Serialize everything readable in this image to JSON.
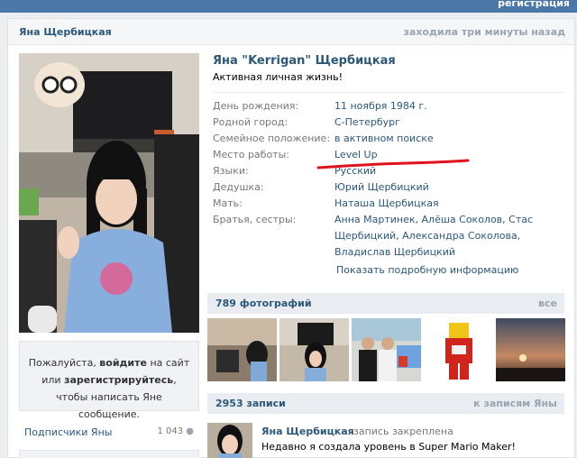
{
  "topbar": {
    "register_label": "регистрация",
    "accent": "#4a76a8"
  },
  "header": {
    "name": "Яна Щербицкая",
    "last_seen": "заходила три минуты назад"
  },
  "profile": {
    "full_name": "Яна \"Kerrigan\" Щербицкая",
    "status": "Активная личная жизнь!",
    "info": [
      {
        "label": "День рождения:",
        "value": "11 ноября 1984 г."
      },
      {
        "label": "Родной город:",
        "value": "С-Петербург"
      },
      {
        "label": "Семейное положение:",
        "value": "в активном поиске"
      },
      {
        "label": "Место работы:",
        "value": "Level Up"
      },
      {
        "label": "Языки:",
        "value": "Русский"
      },
      {
        "label": "Дедушка:",
        "value": "Юрий Щербицкий"
      },
      {
        "label": "Мать:",
        "value": "Наташа Щербицкая"
      },
      {
        "label": "Братья, сестры:",
        "value": "Анна Мартинек, Алёша Соколов, Стас Щербицкий, Александра Соколова, Владислав Щербицкий"
      }
    ],
    "show_more": "Показать подробную информацию"
  },
  "guest_box": {
    "part1": "Пожалуйста, ",
    "login": "войдите",
    "part2": " на сайт или ",
    "register": "зарегистрируйтесь",
    "part3": ", чтобы написать Яне сообщение."
  },
  "subscribers": {
    "label": "Подписчики Яны",
    "count": "1 043"
  },
  "photos": {
    "title": "789 фотографий",
    "all_label": "все"
  },
  "posts": {
    "title": "2953 записи",
    "all_label": "к записям Яны",
    "first": {
      "author": "Яна Щербицкая",
      "pinned": "запись закреплена",
      "text": "Недавно я создала уровень в Super Mario Maker!"
    }
  }
}
